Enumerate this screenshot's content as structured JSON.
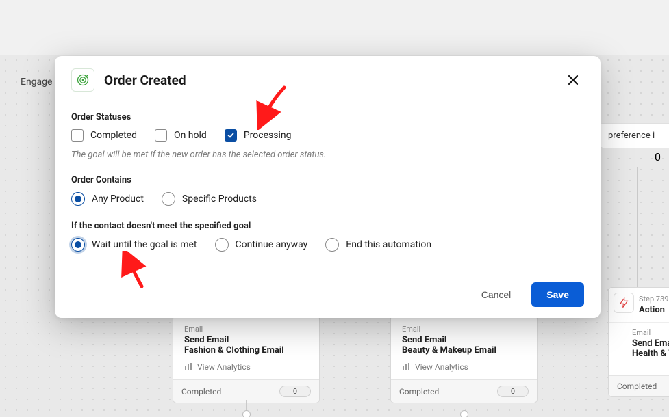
{
  "background": {
    "sidebar_label": "Engage",
    "preference_chip": "preference i",
    "preference_badge": "0",
    "cards": [
      {
        "kicker": "Email",
        "title": "Send Email",
        "subtitle": "Fashion & Clothing Email",
        "analytics": "View Analytics",
        "footer_label": "Completed",
        "footer_count": "0"
      },
      {
        "kicker": "Email",
        "title": "Send Email",
        "subtitle": "Beauty & Makeup Email",
        "analytics": "View Analytics",
        "footer_label": "Completed",
        "footer_count": "0"
      },
      {
        "step": "Step 739",
        "action": "Action",
        "kicker": "Email",
        "title": "Send Emai",
        "subtitle": "Health & W",
        "footer_label": "Completed"
      }
    ]
  },
  "modal": {
    "title": "Order Created",
    "section_statuses": "Order Statuses",
    "status_options": {
      "completed": {
        "label": "Completed",
        "checked": false
      },
      "on_hold": {
        "label": "On hold",
        "checked": false
      },
      "processing": {
        "label": "Processing",
        "checked": true
      }
    },
    "helper": "The goal will be met if the new order has the selected order status.",
    "section_contains": "Order Contains",
    "contains_options": {
      "any": {
        "label": "Any Product",
        "checked": true
      },
      "specific": {
        "label": "Specific Products",
        "checked": false
      }
    },
    "section_goal": "If the contact doesn't meet the specified goal",
    "goal_options": {
      "wait": {
        "label": "Wait until the goal is met",
        "checked": true
      },
      "continue": {
        "label": "Continue anyway",
        "checked": false
      },
      "end": {
        "label": "End this automation",
        "checked": false
      }
    },
    "footer": {
      "cancel": "Cancel",
      "save": "Save"
    }
  }
}
